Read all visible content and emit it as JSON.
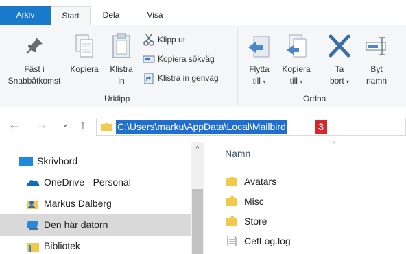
{
  "ribbon_tabs": {
    "file": "Arkiv",
    "start": "Start",
    "share": "Dela",
    "view": "Visa"
  },
  "clipboard": {
    "pin_line1": "Fäst i",
    "pin_line2": "Snabbåtkomst",
    "copy": "Kopiera",
    "paste_line1": "Klistra",
    "paste_line2": "in",
    "cut": "Klipp ut",
    "copy_path": "Kopiera sökväg",
    "paste_shortcut": "Klistra in genväg",
    "group_label": "Urklipp"
  },
  "organize": {
    "move_line1": "Flytta",
    "move_line2": "till",
    "copyto_line1": "Kopiera",
    "copyto_line2": "till",
    "delete_line1": "Ta",
    "delete_line2": "bort",
    "rename_line1": "Byt",
    "rename_line2": "namn",
    "group_label": "Ordna"
  },
  "address": {
    "path": "C:\\Users\\marku\\AppData\\Local\\Mailbird",
    "badge": "3"
  },
  "nav_pane": {
    "items": [
      {
        "label": "Skrivbord"
      },
      {
        "label": "OneDrive - Personal"
      },
      {
        "label": "Markus Dalberg"
      },
      {
        "label": "Den här datorn"
      },
      {
        "label": "Bibliotek"
      }
    ]
  },
  "file_list": {
    "column_name": "Namn",
    "items": [
      {
        "name": "Avatars",
        "type": "folder"
      },
      {
        "name": "Misc",
        "type": "folder"
      },
      {
        "name": "Store",
        "type": "folder"
      },
      {
        "name": "CefLog.log",
        "type": "file"
      }
    ]
  },
  "colors": {
    "accent": "#1979ca",
    "selection": "#1e6fd0",
    "badge": "#d8262b",
    "folder": "#f2c94c"
  }
}
